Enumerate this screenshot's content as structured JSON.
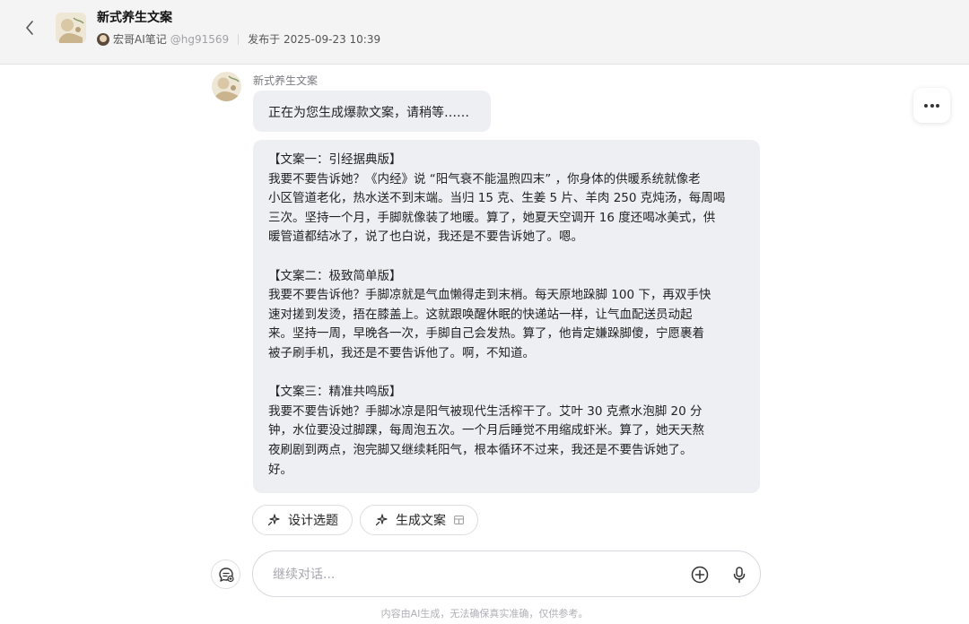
{
  "header": {
    "title": "新式养生文案",
    "author": "宏哥AI笔记",
    "handle": "@hg91569",
    "published": "发布于 2025-09-23 10:39"
  },
  "conversation": {
    "bot_name": "新式养生文案",
    "status_message": "正在为您生成爆款文案，请稍等……",
    "content_blocks": [
      {
        "heading": "【文案一：引经据典版】",
        "lines": [
          "我要不要告诉她？《内经》说 “阳气衰不能温煦四末” ，你身体的供暖系统就像老",
          "小区管道老化，热水送不到末端。当归 15 克、生姜 5 片、羊肉 250 克炖汤，每周喝",
          "三次。坚持一个月，手脚就像装了地暖。算了，她夏天空调开 16 度还喝冰美式，供",
          "暖管道都结冰了，说了也白说，我还是不要告诉她了。嗯。"
        ]
      },
      {
        "heading": "【文案二：极致简单版】",
        "lines": [
          "我要不要告诉他？手脚凉就是气血懒得走到末梢。每天原地跺脚 100 下，再双手快",
          "速对搓到发烫，捂在膝盖上。这就跟唤醒休眠的快递站一样，让气血配送员动起",
          "来。坚持一周，早晚各一次，手脚自己会发热。算了，他肯定嫌跺脚傻，宁愿裹着",
          "被子刷手机，我还是不要告诉他了。啊，不知道。"
        ]
      },
      {
        "heading": "【文案三：精准共鸣版】",
        "lines": [
          "我要不要告诉她？手脚冰凉是阳气被现代生活榨干了。艾叶 30 克煮水泡脚 20 分",
          "钟，水位要没过脚踝，每周泡五次。一个月后睡觉不用缩成虾米。算了，她天天熬",
          "夜刷剧到两点，泡完脚又继续耗阳气，根本循环不过来，我还是不要告诉她了。",
          "好。"
        ]
      }
    ]
  },
  "actions": {
    "design_topic": "设计选题",
    "generate_copy": "生成文案"
  },
  "input": {
    "placeholder": "继续对话..."
  },
  "footer": {
    "disclaimer": "内容由AI生成，无法确保真实准确，仅供参考。"
  },
  "colors": {
    "header_bg": "#f4f4f5",
    "bubble_bg": "#eeeff3",
    "accent": "#1f1f1f"
  },
  "icons": [
    "back-arrow-icon",
    "more-icon",
    "sparkle-icon",
    "pin-icon",
    "table-icon",
    "new-chat-icon",
    "plus-circle-icon",
    "microphone-icon"
  ]
}
